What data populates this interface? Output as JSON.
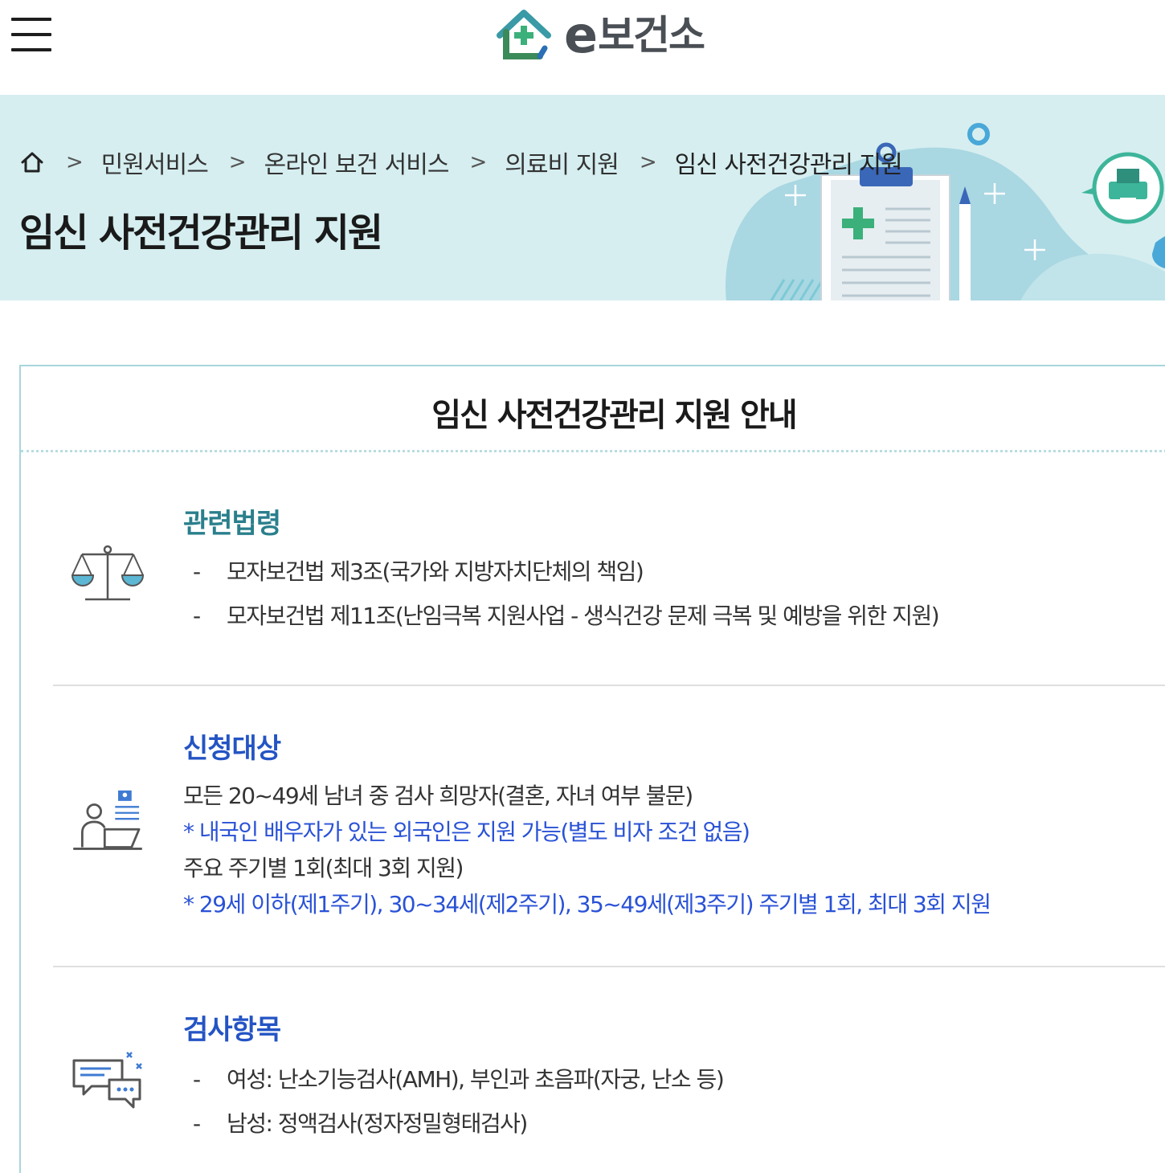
{
  "header": {
    "logo_e": "e",
    "logo_text": "보건소"
  },
  "breadcrumb": {
    "items": [
      "민원서비스",
      "온라인 보건 서비스",
      "의료비 지원",
      "임신 사전건강관리 지원"
    ],
    "separator": ">"
  },
  "banner": {
    "title": "임신 사전건강관리 지원"
  },
  "guide": {
    "title": "임신 사전건강관리 지원 안내",
    "sections": [
      {
        "title": "관련법령",
        "icon": "scale-icon",
        "lines": [
          "모자보건법 제3조(국가와 지방자치단체의 책임)",
          "모자보건법 제11조(난임극복 지원사업 - 생식건강 문제 극복 및 예방을 위한 지원)"
        ]
      },
      {
        "title": "신청대상",
        "icon": "person-laptop-icon",
        "lines": [
          "모든 20~49세 남녀 중 검사 희망자(결혼, 자녀 여부 불문)",
          "* 내국인 배우자가 있는 외국인은 지원 가능(별도 비자 조건 없음)",
          "주요 주기별 1회(최대 3회 지원)",
          "* 29세 이하(제1주기), 30~34세(제2주기), 35~49세(제3주기) 주기별 1회, 최대 3회 지원"
        ]
      },
      {
        "title": "검사항목",
        "icon": "chat-bubbles-icon",
        "lines": [
          "여성: 난소기능검사(AMH), 부인과 초음파(자궁, 난소 등)",
          "남성: 정액검사(정자정밀형태검사)"
        ]
      }
    ]
  },
  "colors": {
    "banner_bg": "#d6eef0",
    "section_title_teal": "#2a7f8c",
    "section_title_blue": "#2454c4",
    "note_blue": "#2a52d6",
    "box_border": "#a8d6db"
  }
}
